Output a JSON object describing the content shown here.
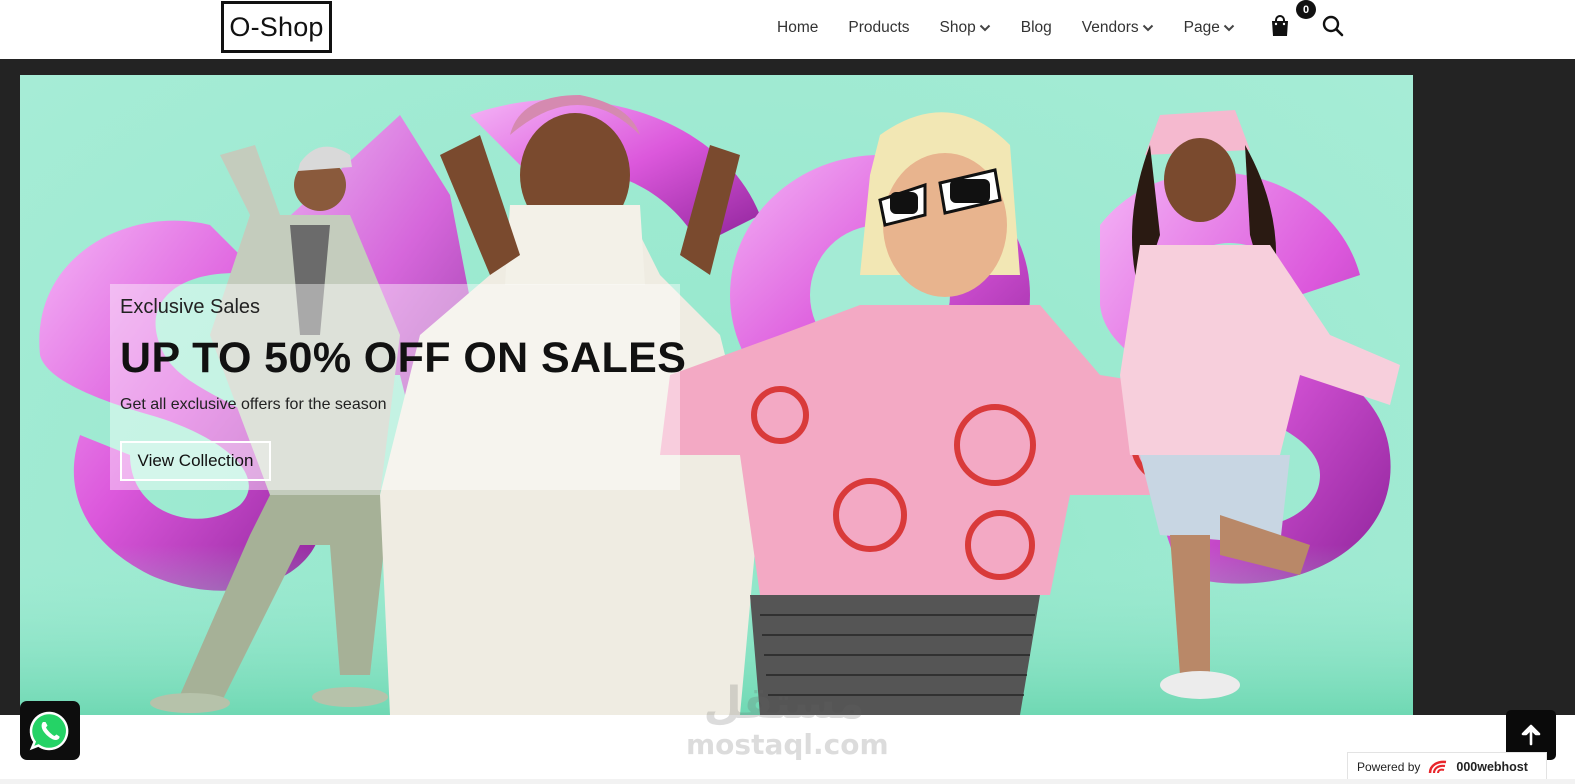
{
  "header": {
    "logo": "O-Shop",
    "nav": [
      {
        "label": "Home",
        "has_dropdown": false
      },
      {
        "label": "Products",
        "has_dropdown": false
      },
      {
        "label": "Shop",
        "has_dropdown": true
      },
      {
        "label": "Blog",
        "has_dropdown": false
      },
      {
        "label": "Vendors",
        "has_dropdown": true
      },
      {
        "label": "Page",
        "has_dropdown": true
      }
    ],
    "cart_icon": "shopping-bag-icon",
    "cart_count": "0",
    "search_icon": "search-icon"
  },
  "hero": {
    "kicker": "Exclusive Sales",
    "title": "UP TO 50% OFF ON SALES",
    "subtitle": "Get all exclusive offers for the season",
    "cta_label": "View Collection",
    "background_color": "#9ae9cf",
    "accent_color": "#d64fd6"
  },
  "floating": {
    "whatsapp_icon": "whatsapp-icon",
    "scroll_top_icon": "arrow-up-icon"
  },
  "watermark": {
    "arabic": "مستقل",
    "latin": "mostaql.com"
  },
  "footer_badge": {
    "prefix": "Powered by",
    "host": "000webhost",
    "host_icon": "000webhost-logo-icon"
  }
}
